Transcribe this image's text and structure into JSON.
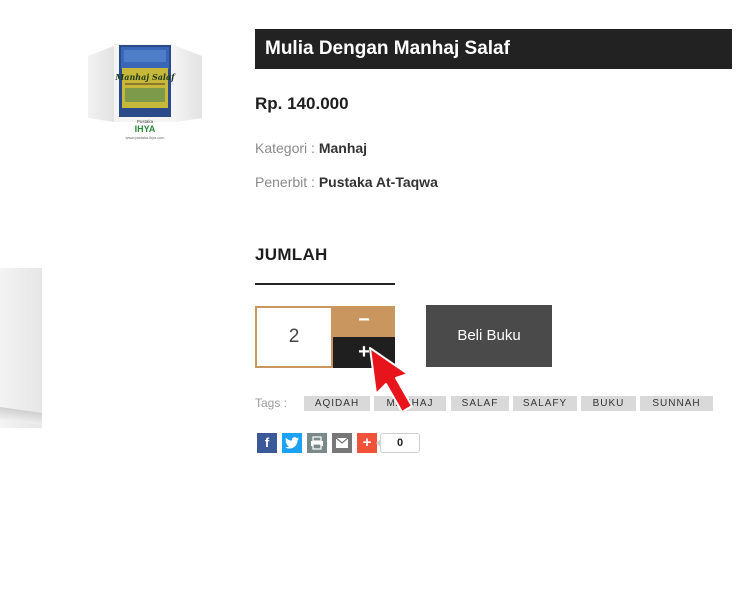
{
  "product": {
    "title": "Mulia Dengan Manhaj Salaf",
    "price": "Rp. 140.000",
    "category_label": "Kategori : ",
    "category_value": "Manhaj",
    "publisher_label": "Penerbit : ",
    "publisher_value": "Pustaka At-Taqwa",
    "thumbnail": {
      "book_title": "Manhaj Salaf",
      "publisher_brand_small": "Pustaka",
      "publisher_brand": "IHYA",
      "website": "www.pustaka-ihya.com"
    }
  },
  "quantity": {
    "label": "JUMLAH",
    "value": "2",
    "minus_label": "−",
    "plus_label": "+"
  },
  "buy_button": {
    "label": "Beli Buku"
  },
  "tags": {
    "label": "Tags :",
    "items": [
      "AQIDAH",
      "MANHAJ",
      "SALAF",
      "SALAFY",
      "BUKU",
      "SUNNAH"
    ]
  },
  "share": {
    "icons": [
      "facebook-icon",
      "twitter-icon",
      "print-icon",
      "email-icon",
      "more-share-icon"
    ],
    "count": "0"
  },
  "colors": {
    "accent": "#c9965f",
    "dark": "#222222",
    "button": "#4a4a4a",
    "facebook": "#3b5998",
    "twitter": "#1da1f2",
    "print": "#7a8a8a",
    "email": "#777777",
    "more": "#f0533a",
    "cursor": "#e8141b"
  }
}
